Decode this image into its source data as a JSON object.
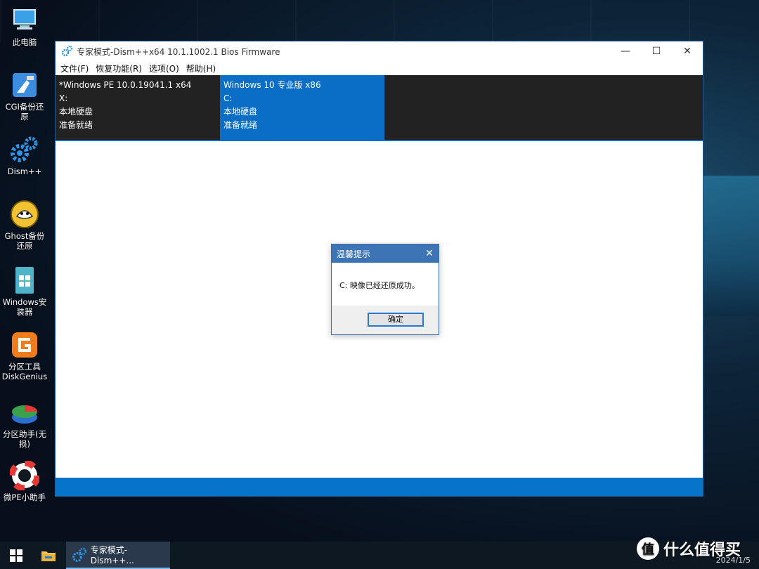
{
  "desktop": {
    "icons": [
      {
        "label": "此电脑",
        "icon": "computer-icon"
      },
      {
        "label": "CGI备份还原",
        "icon": "backup-restore-icon"
      },
      {
        "label": "Dism++",
        "icon": "gears-icon"
      },
      {
        "label": "Ghost备份还原",
        "icon": "ghost-icon"
      },
      {
        "label": "Windows安装器",
        "icon": "windows-installer-icon"
      },
      {
        "label": "分区工具DiskGenius",
        "icon": "diskgenius-icon"
      },
      {
        "label": "分区助手(无损)",
        "icon": "partition-assistant-icon"
      },
      {
        "label": "微PE小助手",
        "icon": "lifebuoy-icon"
      }
    ]
  },
  "window": {
    "title": "专家模式-Dism++x64 10.1.1002.1 Bios Firmware",
    "controls": {
      "minimize": "—",
      "maximize": "☐",
      "close": "✕"
    },
    "menu": [
      "文件(F)",
      "恢复功能(R)",
      "选项(O)",
      "帮助(H)"
    ],
    "panes": [
      {
        "os": "*Windows PE 10.0.19041.1 x64",
        "drive": "X:",
        "type": "本地硬盘",
        "status": "准备就绪",
        "selected": false
      },
      {
        "os": "Windows 10 专业版 x86",
        "drive": "C:",
        "type": "本地硬盘",
        "status": "准备就绪",
        "selected": true
      }
    ]
  },
  "dialog": {
    "title": "温馨提示",
    "message": "C: 映像已经还原成功。",
    "ok_label": "确定",
    "close": "✕"
  },
  "taskbar": {
    "app_label": "专家模式-Dism++...",
    "date": "2024/1/5"
  },
  "watermark": {
    "badge": "值",
    "text": "什么值得买"
  },
  "colors": {
    "accent": "#0a6ec7",
    "dialog_title": "#3d74b5",
    "pane_bg": "#222222"
  }
}
